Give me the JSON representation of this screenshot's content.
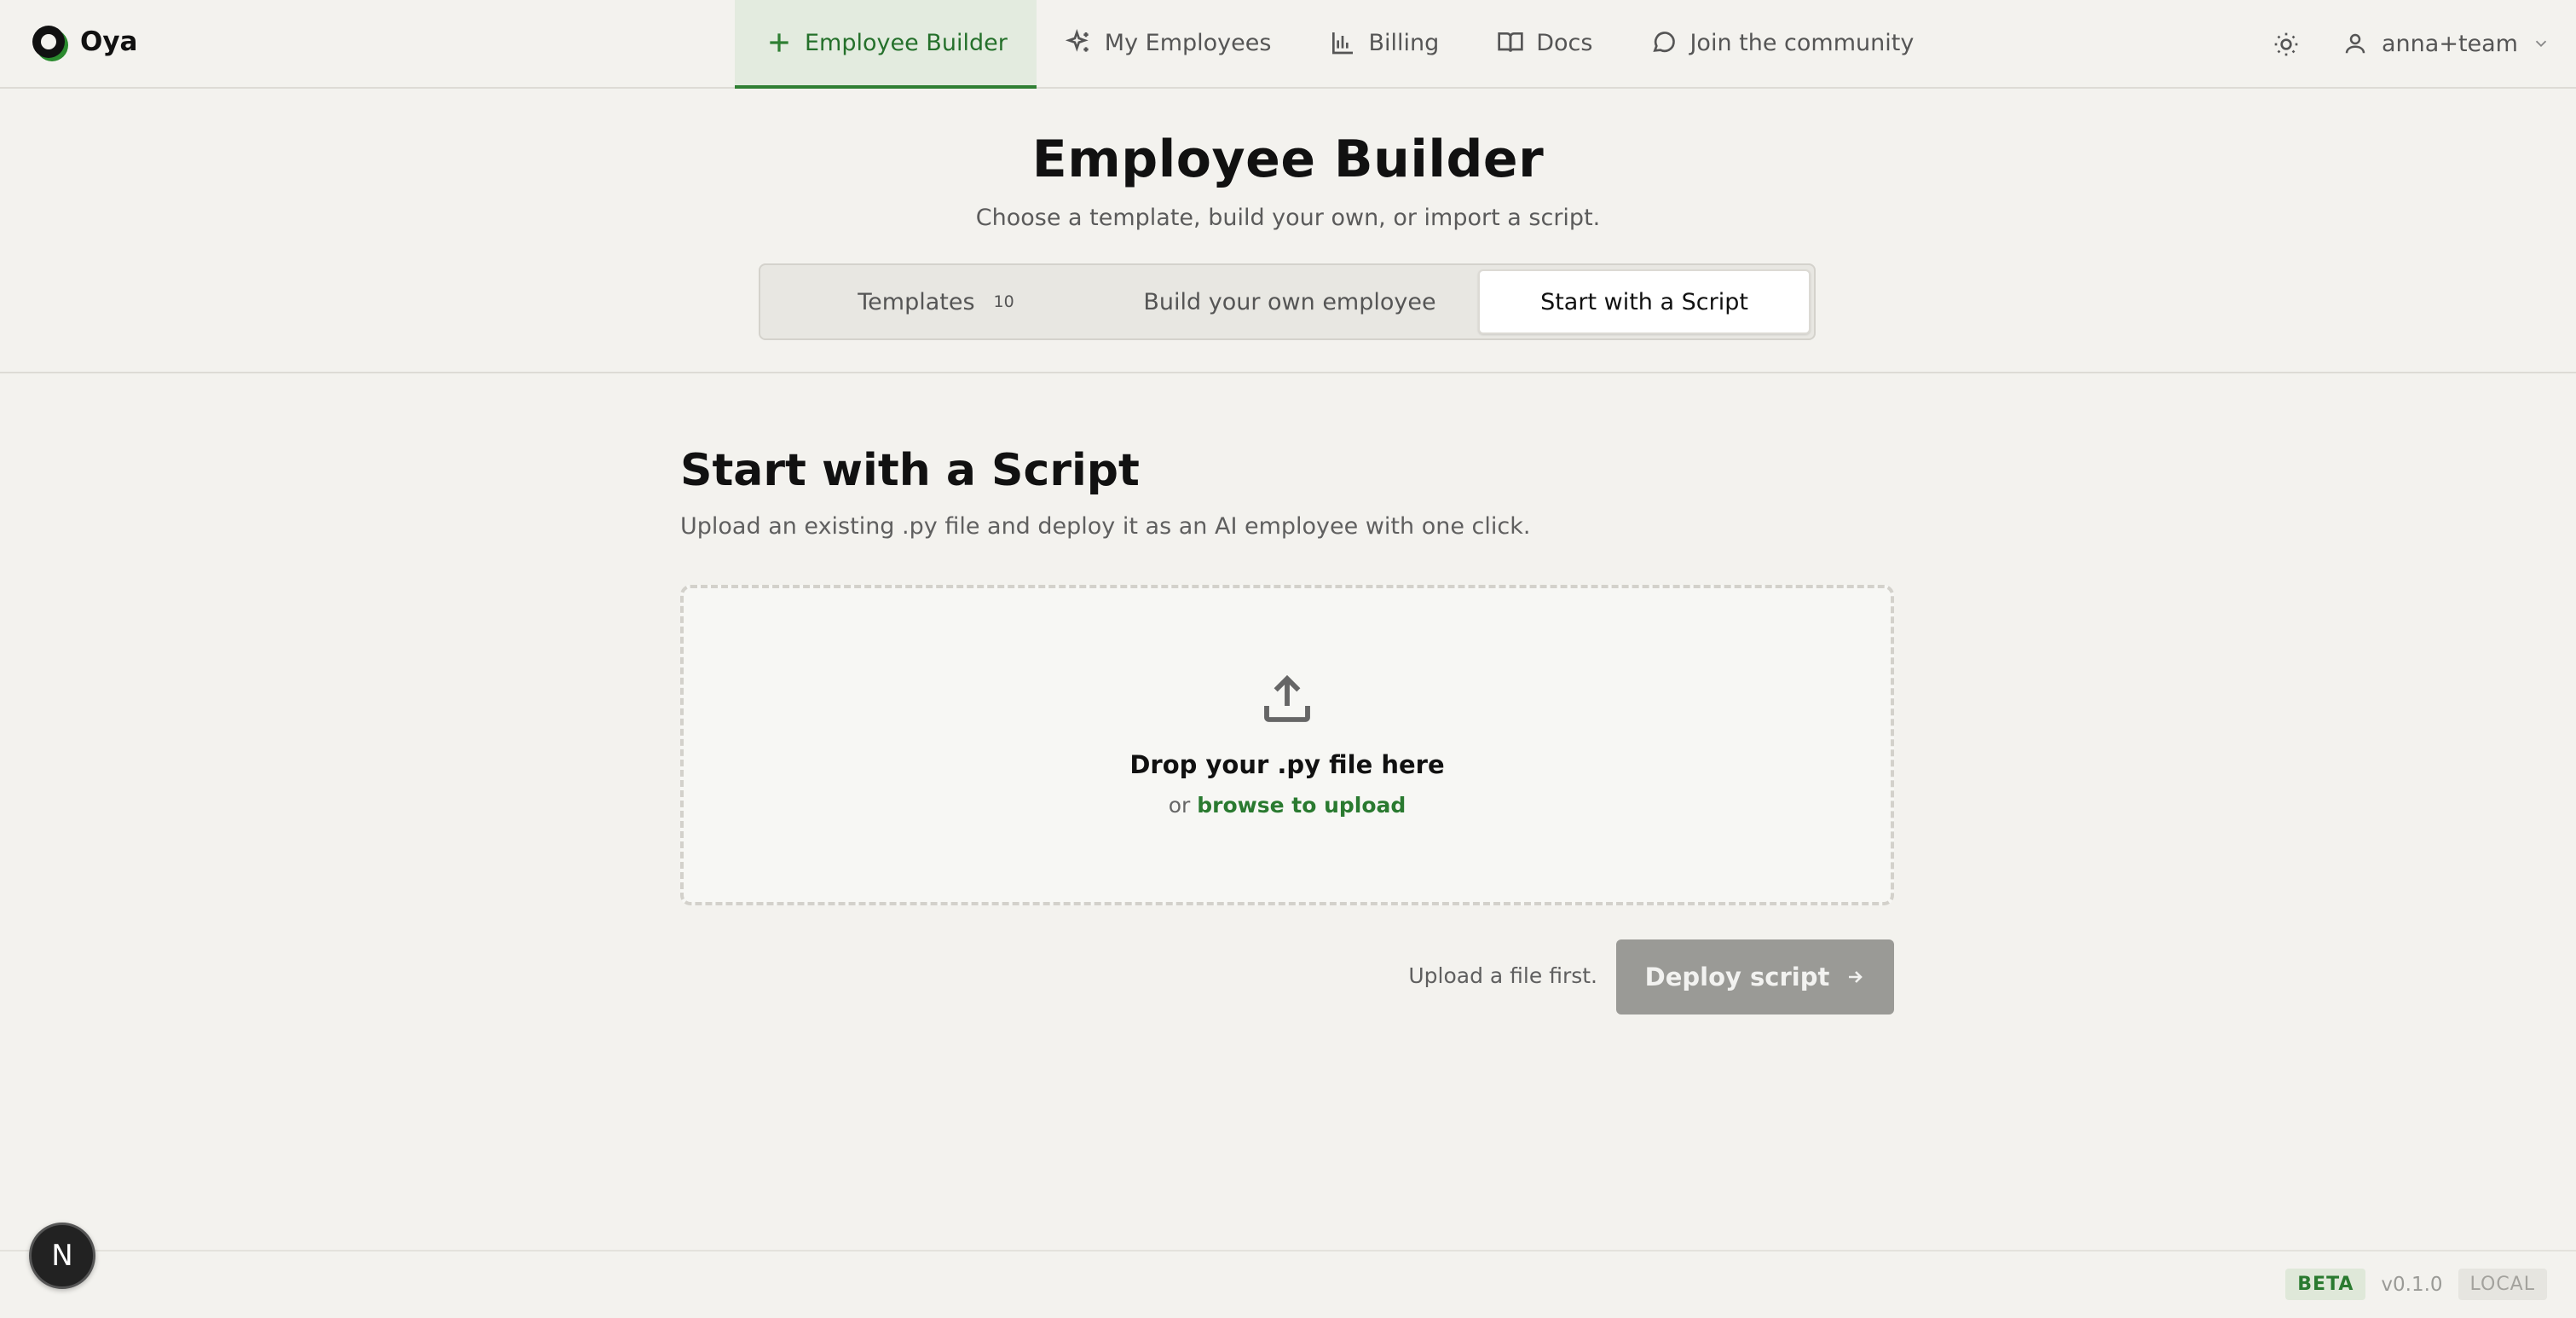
{
  "brand": {
    "name": "Oya"
  },
  "nav": {
    "items": [
      {
        "label": "Employee Builder",
        "icon": "plus-icon",
        "active": true
      },
      {
        "label": "My Employees",
        "icon": "sparkles-icon",
        "active": false
      },
      {
        "label": "Billing",
        "icon": "bar-chart-icon",
        "active": false
      },
      {
        "label": "Docs",
        "icon": "book-icon",
        "active": false
      },
      {
        "label": "Join the community",
        "icon": "chat-bubble-icon",
        "active": false
      }
    ]
  },
  "user": {
    "name": "anna+team"
  },
  "hero": {
    "title": "Employee Builder",
    "subtitle": "Choose a template, build your own, or import a script."
  },
  "tabs": {
    "templates_label": "Templates",
    "templates_count": "10",
    "build_label": "Build your own employee",
    "script_label": "Start with a Script",
    "selected": "Start with a Script"
  },
  "script": {
    "title": "Start with a Script",
    "subtitle": "Upload an existing .py file and deploy it as an AI employee with one click.",
    "drop_title": "Drop your .py file here",
    "drop_or": "or",
    "browse_label": "browse to upload",
    "hint": "Upload a file first.",
    "deploy_label": "Deploy script"
  },
  "footer": {
    "badge_letter": "N",
    "beta": "BETA",
    "version": "v0.1.0",
    "env": "LOCAL"
  },
  "colors": {
    "accent": "#2f7f33",
    "background": "#f3f2ee",
    "button_disabled": "#9a9a96"
  }
}
